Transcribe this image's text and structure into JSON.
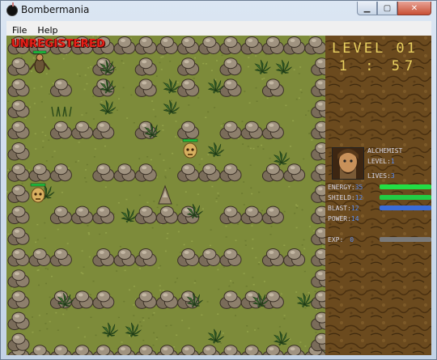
{
  "window": {
    "title": "Bombermania"
  },
  "menu": [
    "File",
    "Help"
  ],
  "game": {
    "banner": "UNREGISTERED",
    "level_label": "LEVEL 01",
    "timer": "1 : 57"
  },
  "player": {
    "name": "ALCHEMIST",
    "level_label": "LEVEL:",
    "level_value": "1",
    "lives_label": "LIVES:",
    "lives_value": "3"
  },
  "stats": [
    {
      "key": "energy",
      "label": "ENERGY:",
      "value": "35",
      "color": "#22dd44",
      "fill": 1.0
    },
    {
      "key": "shield",
      "label": "SHIELD:",
      "value": "12",
      "color": "#22cc44",
      "fill": 1.0
    },
    {
      "key": "blast",
      "label": "BLAST:",
      "value": "12",
      "color": "#3a6cd8",
      "fill": 1.0
    },
    {
      "key": "power",
      "label": "POWER:",
      "value": "14"
    },
    {
      "key": "exp",
      "label": "EXP:",
      "value": "0",
      "color": "#7a7a7a",
      "fill": 1.0
    }
  ],
  "colors": {
    "grass": "#7d8b3a",
    "rock": "#8a7c6a",
    "bush": "#2f5a24",
    "panel": "#6b4a1e",
    "text_gold": "#e8d060",
    "banner": "#e82018"
  }
}
